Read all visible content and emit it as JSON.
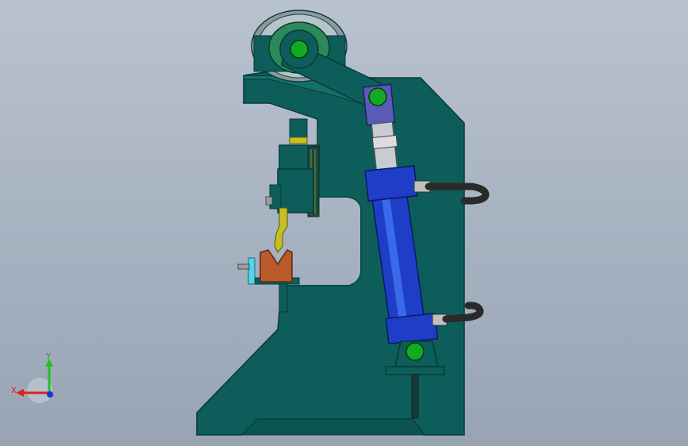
{
  "triad": {
    "x_label": "X",
    "y_label": "Y",
    "x_color": "#e02020",
    "y_color": "#20c020",
    "z_color": "#2030e0"
  },
  "colors": {
    "frame": "#0d5e5a",
    "frame_edge": "#073a38",
    "cylinder": "#1f3ec7",
    "pin": "#11aa22",
    "workpiece": "#b85a2a",
    "punch": "#c8c020",
    "hose": "#2a2a2a"
  }
}
